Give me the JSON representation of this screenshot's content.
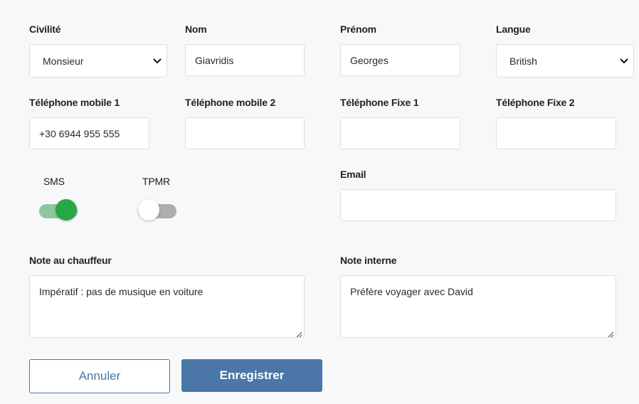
{
  "form": {
    "civilite": {
      "label": "Civilité",
      "value": "Monsieur"
    },
    "nom": {
      "label": "Nom",
      "value": "Giavridis"
    },
    "prenom": {
      "label": "Prénom",
      "value": "Georges"
    },
    "langue": {
      "label": "Langue",
      "value": "British"
    },
    "tel_mobile_1": {
      "label": "Téléphone mobile 1",
      "value": "+30 6944 955 555"
    },
    "tel_mobile_2": {
      "label": "Téléphone mobile 2",
      "value": ""
    },
    "tel_fixe_1": {
      "label": "Téléphone Fixe 1",
      "value": ""
    },
    "tel_fixe_2": {
      "label": "Téléphone Fixe 2",
      "value": ""
    },
    "sms": {
      "label": "SMS",
      "checked": true
    },
    "tpmr": {
      "label": "TPMR",
      "checked": false
    },
    "email": {
      "label": "Email",
      "value": ""
    },
    "note_chauffeur": {
      "label": "Note au chauffeur",
      "value": "Impératif : pas de musique en voiture"
    },
    "note_interne": {
      "label": "Note interne",
      "value": "Préfère voyager avec David"
    }
  },
  "actions": {
    "cancel_label": "Annuler",
    "save_label": "Enregistrer"
  },
  "colors": {
    "primary": "#4a76a8",
    "toggle_on": "#28a745",
    "toggle_on_track": "#8fc79c",
    "toggle_off_track": "#adadad",
    "background": "#f7f8fa"
  },
  "icons": {
    "select_chevron": "chevron-down-icon",
    "textarea_resize": "resize-handle-icon"
  }
}
